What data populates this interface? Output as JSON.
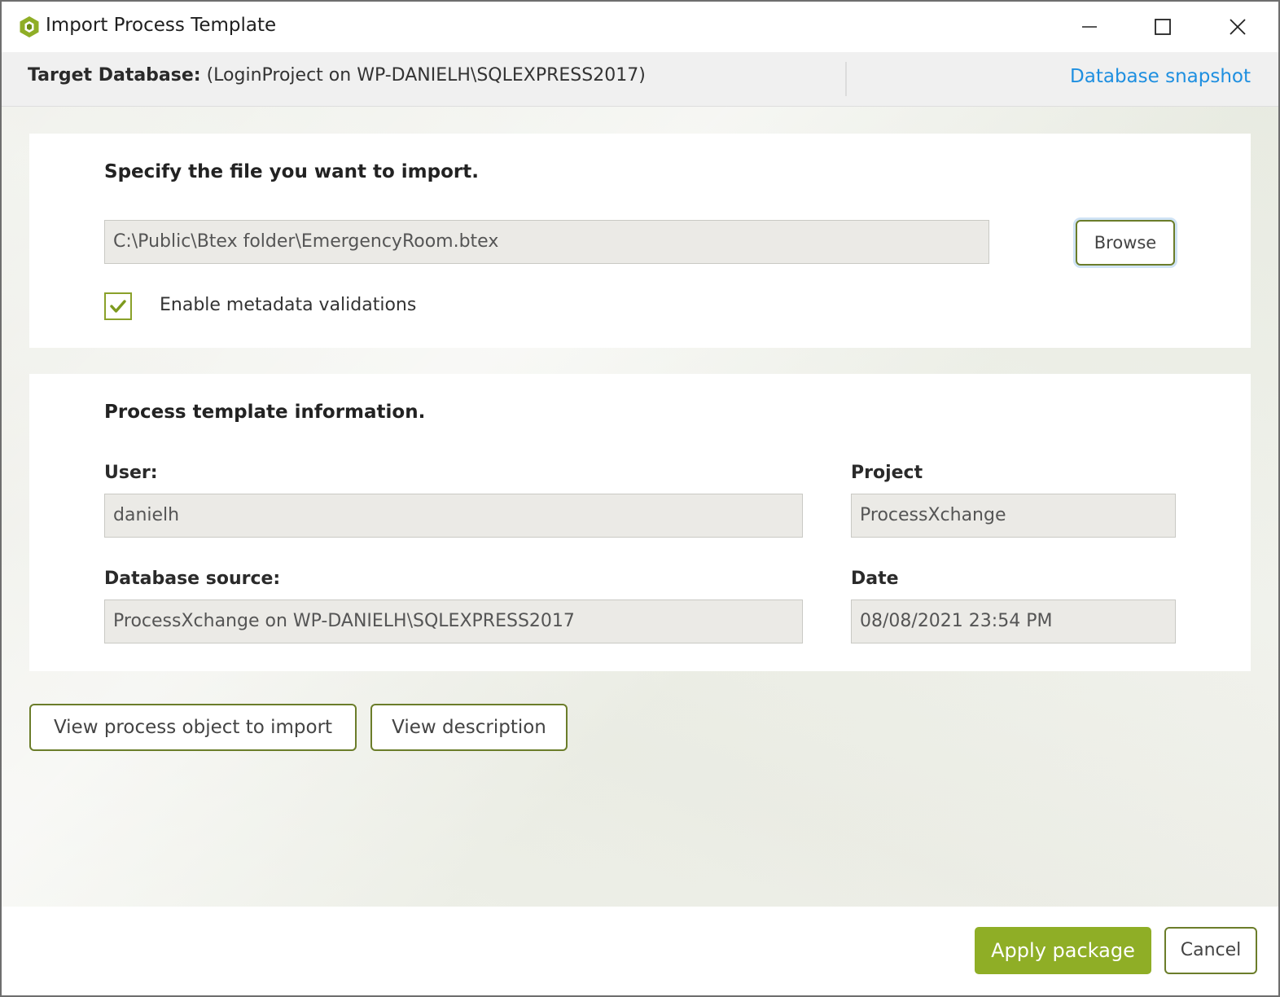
{
  "window": {
    "title": "Import Process Template",
    "controls": {
      "minimize": "minimize-icon",
      "maximize": "maximize-icon",
      "close": "close-icon"
    }
  },
  "target_database": {
    "label": "Target Database:",
    "value": "(LoginProject on WP-DANIELH\\SQLEXPRESS2017)",
    "snapshot_link": "Database snapshot"
  },
  "file_section": {
    "title": "Specify the file you want to import.",
    "file_path": "C:\\Public\\Btex folder\\EmergencyRoom.btex",
    "browse_label": "Browse",
    "metadata_checkbox_label": "Enable metadata validations",
    "metadata_checked": true
  },
  "info_section": {
    "title": "Process template information.",
    "user_label": "User:",
    "user_value": "danielh",
    "project_label": "Project",
    "project_value": "ProcessXchange",
    "db_source_label": "Database source:",
    "db_source_value": "ProcessXchange on WP-DANIELH\\SQLEXPRESS2017",
    "date_label": "Date",
    "date_value": "08/08/2021 23:54 PM"
  },
  "actions": {
    "view_objects_label": "View process object to import",
    "view_description_label": "View description"
  },
  "footer": {
    "apply_label": "Apply package",
    "cancel_label": "Cancel"
  },
  "colors": {
    "accent": "#8fae26",
    "button_border": "#6b7d2a",
    "link": "#1e8fe0",
    "field_bg": "#ebeae6"
  }
}
